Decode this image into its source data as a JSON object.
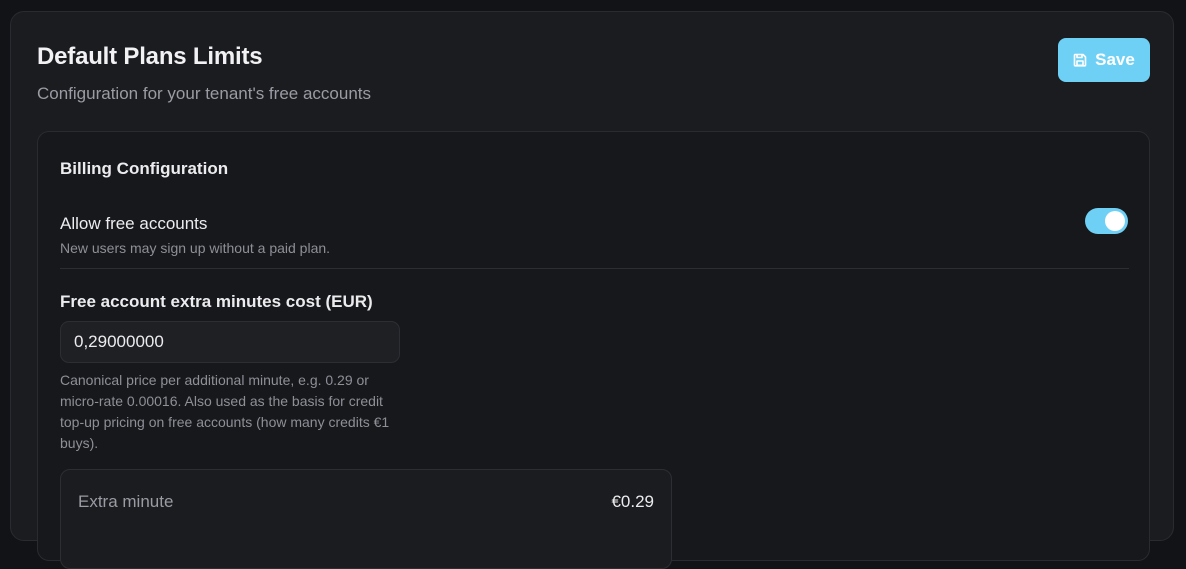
{
  "header": {
    "title": "Default Plans Limits",
    "subtitle": "Configuration for your tenant's free accounts",
    "save_label": "Save",
    "save_icon": "save-icon"
  },
  "billing": {
    "title": "Billing Configuration",
    "allow_free": {
      "label": "Allow free accounts",
      "description": "New users may sign up without a paid plan.",
      "enabled": true
    },
    "extra_minutes_cost": {
      "label": "Free account extra minutes cost (EUR)",
      "value": "0,29000000",
      "help": "Canonical price per additional minute, e.g. 0.29 or micro-rate 0.00016. Also used as the basis for credit top-up pricing on free accounts (how many credits €1 buys)."
    },
    "summary": {
      "label": "Extra minute",
      "value": "€0.29"
    }
  },
  "colors": {
    "accent": "#6fd0f5",
    "background": "#121317",
    "panel": "#1b1c20"
  }
}
